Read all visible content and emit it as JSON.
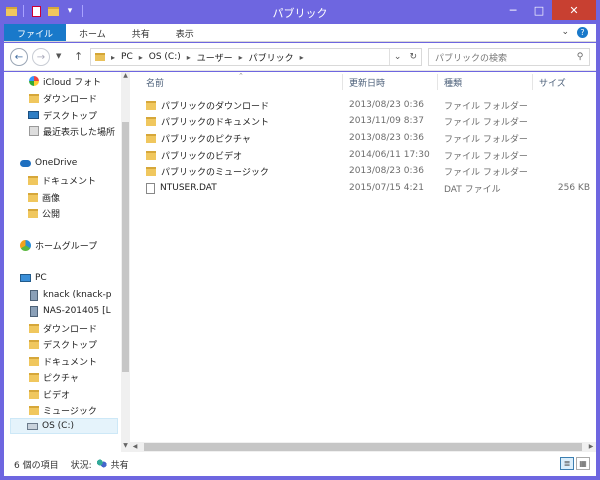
{
  "window": {
    "title": "パブリック",
    "buttons": {
      "minimize": "─",
      "maximize": "□",
      "close": "✕"
    }
  },
  "ribbon": {
    "tabs": [
      {
        "label": "ファイル",
        "active": true
      },
      {
        "label": "ホーム"
      },
      {
        "label": "共有"
      },
      {
        "label": "表示"
      }
    ],
    "expand_icon": "chevron-down-icon",
    "help_icon": "help-icon"
  },
  "address": {
    "crumbs": [
      "PC",
      "OS (C:)",
      "ユーザー",
      "パブリック"
    ],
    "search_placeholder": "パブリックの検索"
  },
  "nav": {
    "favorites": [
      {
        "label": "iCloud フォト",
        "icon": "icloud-icon"
      },
      {
        "label": "ダウンロード",
        "icon": "downloads-icon"
      },
      {
        "label": "デスクトップ",
        "icon": "desktop-icon"
      },
      {
        "label": "最近表示した場所",
        "icon": "recent-places-icon"
      }
    ],
    "onedrive": {
      "label": "OneDrive",
      "items": [
        "ドキュメント",
        "画像",
        "公開"
      ]
    },
    "homegroup": "ホームグループ",
    "pc": {
      "label": "PC",
      "items": [
        {
          "label": "knack (knack-p",
          "icon": "network-computer-icon"
        },
        {
          "label": "NAS-201405 [L",
          "icon": "network-computer-icon"
        },
        {
          "label": "ダウンロード",
          "icon": "downloads-icon"
        },
        {
          "label": "デスクトップ",
          "icon": "desktop-icon"
        },
        {
          "label": "ドキュメント",
          "icon": "documents-icon"
        },
        {
          "label": "ピクチャ",
          "icon": "pictures-icon"
        },
        {
          "label": "ビデオ",
          "icon": "videos-icon"
        },
        {
          "label": "ミュージック",
          "icon": "music-icon"
        },
        {
          "label": "OS (C:)",
          "icon": "drive-icon",
          "selected": true
        }
      ]
    }
  },
  "columns": {
    "name": "名前",
    "date": "更新日時",
    "type": "種類",
    "size": "サイズ"
  },
  "files": [
    {
      "name": "パブリックのダウンロード",
      "date": "2013/08/23 0:36",
      "type": "ファイル フォルダー",
      "size": "",
      "kind": "folder"
    },
    {
      "name": "パブリックのドキュメント",
      "date": "2013/11/09 8:37",
      "type": "ファイル フォルダー",
      "size": "",
      "kind": "folder"
    },
    {
      "name": "パブリックのピクチャ",
      "date": "2013/08/23 0:36",
      "type": "ファイル フォルダー",
      "size": "",
      "kind": "folder"
    },
    {
      "name": "パブリックのビデオ",
      "date": "2014/06/11 17:30",
      "type": "ファイル フォルダー",
      "size": "",
      "kind": "folder"
    },
    {
      "name": "パブリックのミュージック",
      "date": "2013/08/23 0:36",
      "type": "ファイル フォルダー",
      "size": "",
      "kind": "folder"
    },
    {
      "name": "NTUSER.DAT",
      "date": "2015/07/15 4:21",
      "type": "DAT ファイル",
      "size": "256 KB",
      "kind": "file"
    }
  ],
  "status": {
    "count": "6 個の項目",
    "state_label": "状況:",
    "state_value": "共有"
  },
  "colors": {
    "titlebar": "#6e66e0",
    "file_tab": "#1979ca",
    "close": "#c84031",
    "folder": "#f0c75e"
  }
}
